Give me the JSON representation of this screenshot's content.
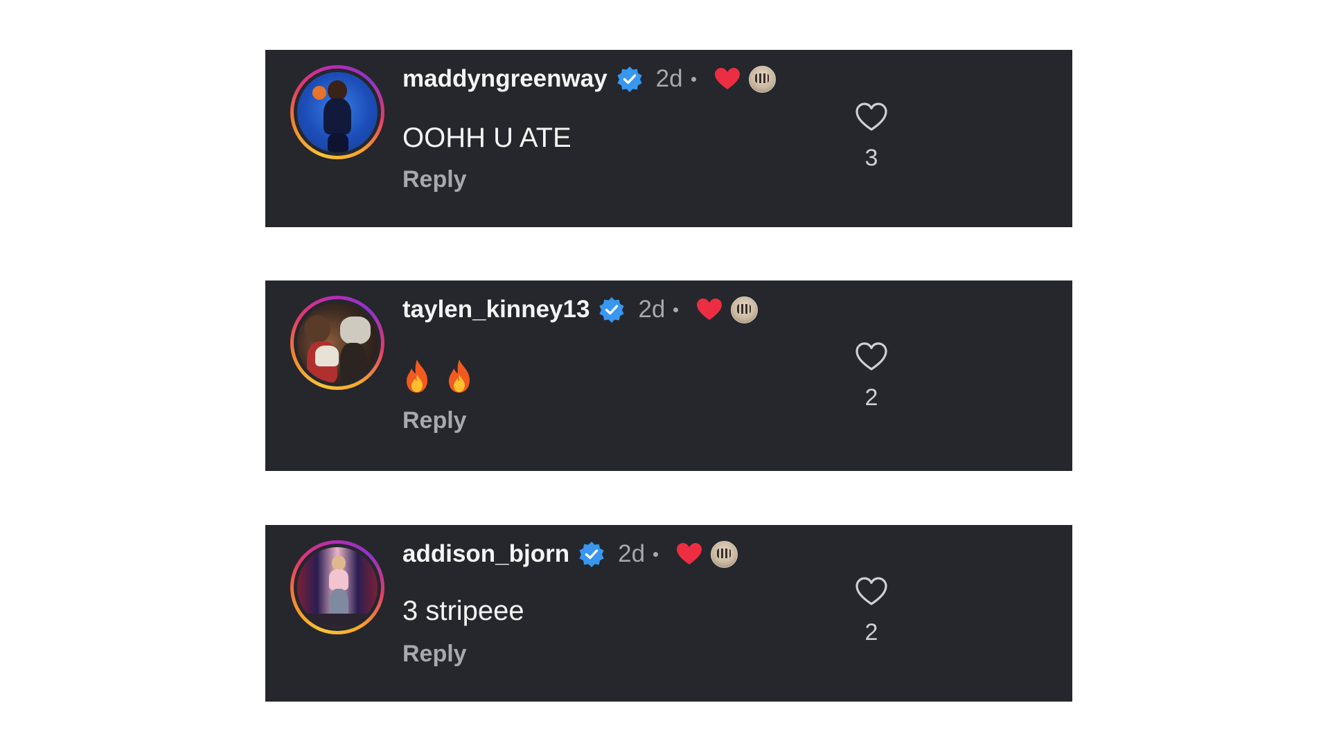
{
  "comments": [
    {
      "username": "maddyngreenway",
      "time": "2d",
      "text": "OOHH U ATE",
      "reply_label": "Reply",
      "likes": "3",
      "verified": true,
      "liked_by_creator": true
    },
    {
      "username": "taylen_kinney13",
      "time": "2d",
      "text": "🔥🔥",
      "reply_label": "Reply",
      "likes": "2",
      "verified": true,
      "liked_by_creator": true
    },
    {
      "username": "addison_bjorn",
      "time": "2d",
      "text": "3 stripeee",
      "reply_label": "Reply",
      "likes": "2",
      "verified": true,
      "liked_by_creator": true
    }
  ],
  "colors": {
    "card_background": "#25272c",
    "verified_badge": "#3897f0",
    "liked_heart": "#ed2d42",
    "secondary_text": "#a8a8ad"
  }
}
